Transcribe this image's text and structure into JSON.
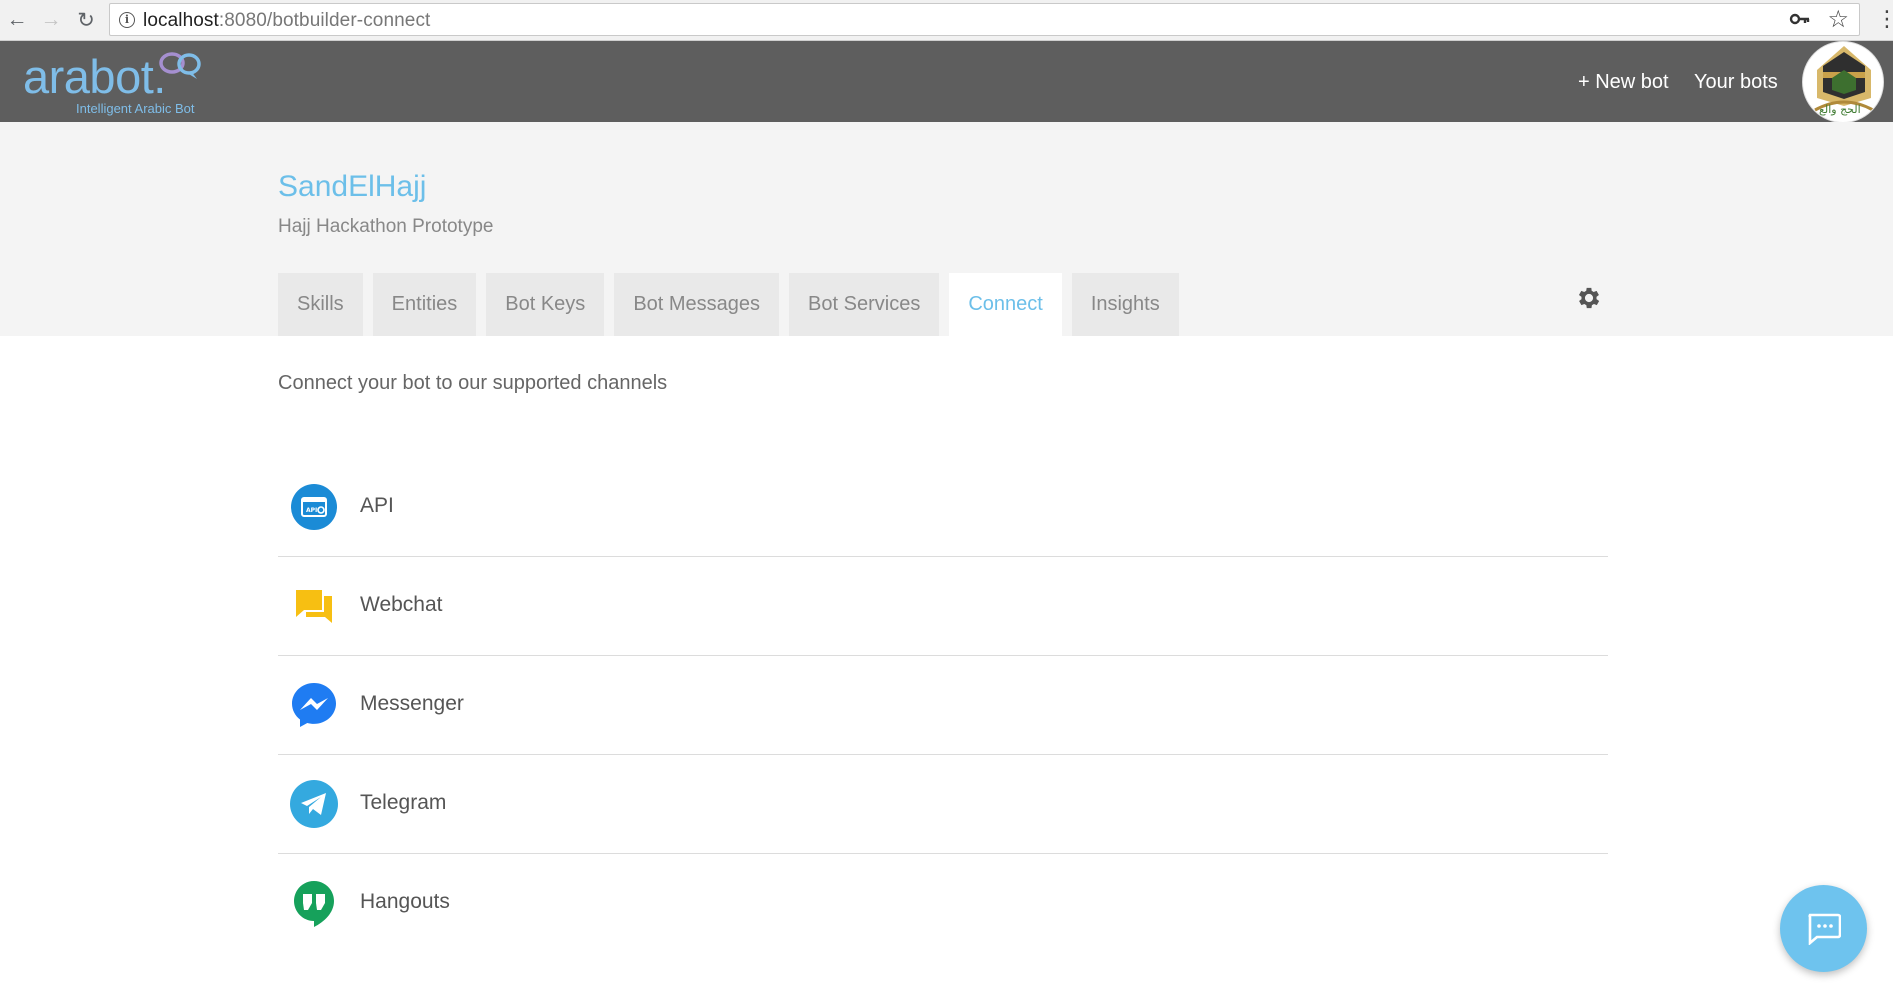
{
  "browser": {
    "url_host": "localhost",
    "url_rest": ":8080/botbuilder-connect",
    "icons": [
      "back-icon",
      "forward-icon",
      "reload-icon",
      "info-icon",
      "key-icon",
      "star-icon",
      "menu-icon"
    ]
  },
  "header": {
    "logo_text": "arabot.",
    "logo_tagline": "Intelligent Arabic Bot",
    "new_bot_label": "+ New bot",
    "your_bots_label": "Your bots",
    "avatar_text": "الحج والع"
  },
  "bot": {
    "name": "SandElHajj",
    "subtitle": "Hajj Hackathon Prototype"
  },
  "tabs": [
    {
      "label": "Skills",
      "active": false
    },
    {
      "label": "Entities",
      "active": false
    },
    {
      "label": "Bot Keys",
      "active": false
    },
    {
      "label": "Bot Messages",
      "active": false
    },
    {
      "label": "Bot Services",
      "active": false
    },
    {
      "label": "Connect",
      "active": true
    },
    {
      "label": "Insights",
      "active": false
    }
  ],
  "connect": {
    "lead": "Connect your bot to our supported channels",
    "api_icon_text": "API",
    "channels": [
      {
        "label": "API",
        "icon": "api-icon",
        "color": "#1b8bd6"
      },
      {
        "label": "Webchat",
        "icon": "webchat-icon",
        "color": "#f7bf12"
      },
      {
        "label": "Messenger",
        "icon": "messenger-icon",
        "color": "#1f7cf2"
      },
      {
        "label": "Telegram",
        "icon": "telegram-icon",
        "color": "#34a9df"
      },
      {
        "label": "Hangouts",
        "icon": "hangouts-icon",
        "color": "#16a15b"
      }
    ]
  },
  "colors": {
    "accent": "#6cbfe9",
    "appbar": "#5e5e5e",
    "botbar": "#f4f4f4"
  }
}
